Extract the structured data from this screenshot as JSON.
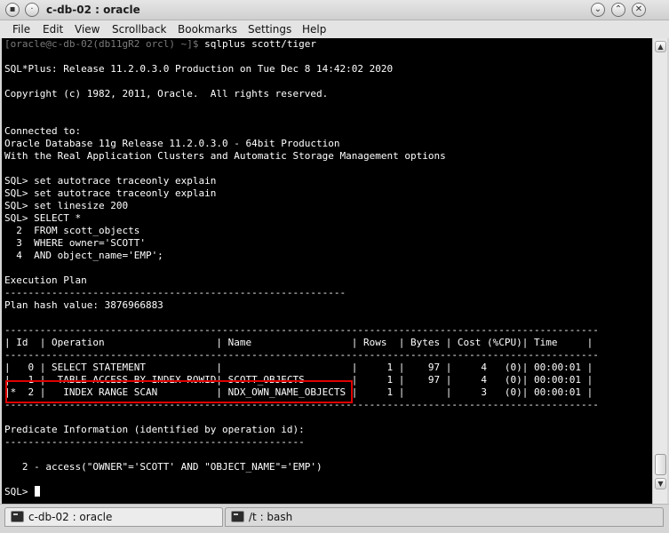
{
  "window": {
    "title": "c-db-02 : oracle",
    "menu_icon": "window-menu-icon",
    "pin_icon": "pin-icon",
    "minimize_icon": "chevron-down-icon",
    "maximize_icon": "chevron-up-icon",
    "close_icon": "close-icon"
  },
  "menubar": {
    "items": [
      "File",
      "Edit",
      "View",
      "Scrollback",
      "Bookmarks",
      "Settings",
      "Help"
    ]
  },
  "terminal": {
    "prompt": "[oracle@c-db-02(db11gR2 orcl) ~]$",
    "command": " sqlplus scott/tiger",
    "lines": [
      "",
      "SQL*Plus: Release 11.2.0.3.0 Production on Tue Dec 8 14:42:02 2020",
      "",
      "Copyright (c) 1982, 2011, Oracle.  All rights reserved.",
      "",
      "",
      "Connected to:",
      "Oracle Database 11g Release 11.2.0.3.0 - 64bit Production",
      "With the Real Application Clusters and Automatic Storage Management options",
      "",
      "SQL> set autotrace traceonly explain",
      "SQL> set autotrace traceonly explain",
      "SQL> set linesize 200",
      "SQL> SELECT *",
      "  2  FROM scott_objects",
      "  3  WHERE owner='SCOTT'",
      "  4  AND object_name='EMP';",
      "",
      "Execution Plan",
      "----------------------------------------------------------",
      "Plan hash value: 3876966883",
      "",
      "-----------------------------------------------------------------------------------------------------",
      "| Id  | Operation                   | Name                 | Rows  | Bytes | Cost (%CPU)| Time     |",
      "-----------------------------------------------------------------------------------------------------",
      "|   0 | SELECT STATEMENT            |                      |     1 |    97 |     4   (0)| 00:00:01 |",
      "|   1 |  TABLE ACCESS BY INDEX ROWID| SCOTT_OBJECTS        |     1 |    97 |     4   (0)| 00:00:01 |",
      "|*  2 |   INDEX RANGE SCAN          | NDX_OWN_NAME_OBJECTS |     1 |       |     3   (0)| 00:00:01 |",
      "-----------------------------------------------------------------------------------------------------",
      "",
      "Predicate Information (identified by operation id):",
      "---------------------------------------------------",
      "",
      "   2 - access(\"OWNER\"='SCOTT' AND \"OBJECT_NAME\"='EMP')",
      "",
      "SQL> "
    ]
  },
  "tabs": [
    {
      "label": "c-db-02 : oracle",
      "icon": "terminal-icon"
    },
    {
      "label": "/t : bash",
      "icon": "terminal-icon"
    }
  ]
}
